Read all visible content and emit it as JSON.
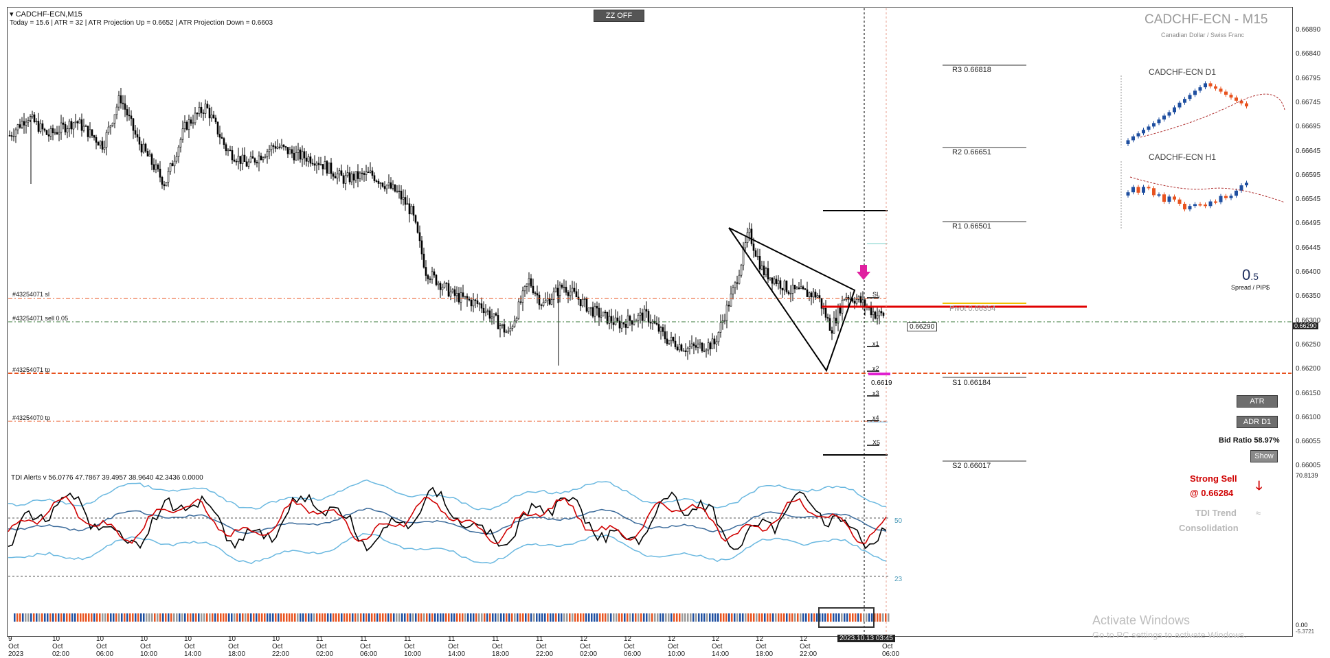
{
  "header": {
    "symbol": "CADCHF-ECN,M15",
    "stats": "Today = 15.6   |   ATR = 32   |   ATR Projection Up = 0.6652   |   ATR Projection Down = 0.6603"
  },
  "zz_button": "ZZ OFF",
  "watermark": {
    "title": "CADCHF-ECN - M15",
    "subtitle": "Canadian Dollar / Swiss Franc"
  },
  "mini_charts": [
    {
      "label": "CADCHF-ECN D1"
    },
    {
      "label": "CADCHF-ECN H1"
    }
  ],
  "pivots": {
    "r3": "R3 0.66818",
    "r2": "R2 0.66651",
    "r1": "R1 0.66501",
    "pivot": "Pivot 0.66354",
    "s1": "S1 0.66184",
    "s2": "S2 0.66017"
  },
  "orders": {
    "sl": "#43254071 sl",
    "sell": "#43254071 sell 0.05",
    "tp": "#43254071 tp",
    "tp2": "#43254070 tp"
  },
  "targets": {
    "sl": "SL",
    "x1": "x1",
    "x2": "x2",
    "x3": "x3",
    "x4": "x4",
    "x5": "X5",
    "level": "0.6619"
  },
  "price_tag": "0.66290",
  "spread": {
    "value_main": "0",
    "value_decimal": ".5",
    "label": "Spread / PIP$"
  },
  "buttons": {
    "atr": "ATR",
    "adr": "ADR D1",
    "show": "Show"
  },
  "bid_ratio": "Bid Ratio 58.97%",
  "tdi": {
    "header": "TDI Alerts v 56.0776 47.7867 39.4957 38.9640 42.3436 0.0000",
    "signal": "Strong Sell",
    "signal_price": "@ 0.66284",
    "trend_label": "TDI Trend",
    "trend_value": "Consolidation",
    "level_50": "50",
    "level_23": "23",
    "axis_top": "70.8139",
    "axis_bottom": "0.00",
    "axis_bottom2": "-5.3721"
  },
  "price_axis": [
    "0.66890",
    "0.66840",
    "0.66795",
    "0.66745",
    "0.66695",
    "0.66645",
    "0.66595",
    "0.66545",
    "0.66495",
    "0.66445",
    "0.66400",
    "0.66350",
    "0.66300",
    "0.66250",
    "0.66200",
    "0.66150",
    "0.66100",
    "0.66055",
    "0.66005"
  ],
  "current_price": "0.66290",
  "time_axis": [
    "9 Oct 2023",
    "10 Oct 02:00",
    "10 Oct 06:00",
    "10 Oct 10:00",
    "10 Oct 14:00",
    "10 Oct 18:00",
    "10 Oct 22:00",
    "11 Oct 02:00",
    "11 Oct 06:00",
    "11 Oct 10:00",
    "11 Oct 14:00",
    "11 Oct 18:00",
    "11 Oct 22:00",
    "12 Oct 02:00",
    "12 Oct 06:00",
    "12 Oct 10:00",
    "12 Oct 14:00",
    "12 Oct 18:00",
    "12 Oct 22:00",
    "13 Oct 06:00"
  ],
  "cursor_time": "2023.10.13 03:45",
  "activate": {
    "title": "Activate Windows",
    "sub": "Go to PC settings to activate Windows."
  },
  "colors": {
    "bull": "#1f4fa0",
    "bear": "#e8531f",
    "rsi": "#000000",
    "signal": "#d00000",
    "band": "#6ab8e0",
    "mid": "#3a6a9a"
  }
}
